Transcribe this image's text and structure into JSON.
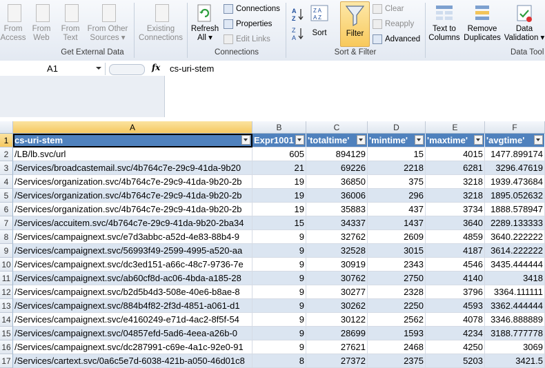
{
  "ribbon": {
    "get_external_data": {
      "label": "Get External Data",
      "buttons": [
        {
          "line1": "From",
          "line2": "Access"
        },
        {
          "line1": "From",
          "line2": "Web"
        },
        {
          "line1": "From",
          "line2": "Text"
        },
        {
          "line1": "From Other",
          "line2": "Sources ▾"
        },
        {
          "line1": "Existing",
          "line2": "Connections"
        }
      ]
    },
    "connections": {
      "label": "Connections",
      "refresh_line1": "Refresh",
      "refresh_line2": "All ▾",
      "connections": "Connections",
      "properties": "Properties",
      "edit_links": "Edit Links"
    },
    "sort_filter": {
      "label": "Sort & Filter",
      "sort": "Sort",
      "filter": "Filter",
      "clear": "Clear",
      "reapply": "Reapply",
      "advanced": "Advanced"
    },
    "data_tools": {
      "label": "Data Tool",
      "text_to_columns_1": "Text to",
      "text_to_columns_2": "Columns",
      "remove_duplicates_1": "Remove",
      "remove_duplicates_2": "Duplicates",
      "data_validation_1": "Data",
      "data_validation_2": "Validation ▾"
    }
  },
  "formula_bar": {
    "name_box": "A1",
    "fx": "fx",
    "formula": "cs-uri-stem"
  },
  "columns": [
    "A",
    "B",
    "C",
    "D",
    "E",
    "F"
  ],
  "header_row": {
    "num": "1",
    "cells": [
      "cs-uri-stem",
      "Expr1001",
      "'totaltime'",
      "'mintime'",
      "'maxtime'",
      "'avgtime'"
    ]
  },
  "rows": [
    {
      "num": "2",
      "cells": [
        "/LB/lb.svc/url",
        "605",
        "894129",
        "15",
        "4015",
        "1477.899174"
      ]
    },
    {
      "num": "3",
      "cells": [
        "/Services/broadcastemail.svc/4b764c7e-29c9-41da-9b20",
        "21",
        "69226",
        "2218",
        "6281",
        "3296.47619"
      ]
    },
    {
      "num": "4",
      "cells": [
        "/Services/organization.svc/4b764c7e-29c9-41da-9b20-2b",
        "19",
        "36850",
        "375",
        "3218",
        "1939.473684"
      ]
    },
    {
      "num": "5",
      "cells": [
        "/Services/organization.svc/4b764c7e-29c9-41da-9b20-2b",
        "19",
        "36006",
        "296",
        "3218",
        "1895.052632"
      ]
    },
    {
      "num": "6",
      "cells": [
        "/Services/organization.svc/4b764c7e-29c9-41da-9b20-2b",
        "19",
        "35883",
        "437",
        "3734",
        "1888.578947"
      ]
    },
    {
      "num": "7",
      "cells": [
        "/Services/accuitem.svc/4b764c7e-29c9-41da-9b20-2ba34",
        "15",
        "34337",
        "1437",
        "3640",
        "2289.133333"
      ]
    },
    {
      "num": "8",
      "cells": [
        "/Services/campaignext.svc/e7d3abbc-a52d-4e83-88b4-9",
        "9",
        "32762",
        "2609",
        "4859",
        "3640.222222"
      ]
    },
    {
      "num": "9",
      "cells": [
        "/Services/campaignext.svc/56993f49-2599-4995-a520-aa",
        "9",
        "32528",
        "3015",
        "4187",
        "3614.222222"
      ]
    },
    {
      "num": "10",
      "cells": [
        "/Services/campaignext.svc/dc3ed151-a66c-48c7-9736-7e",
        "9",
        "30919",
        "2343",
        "4546",
        "3435.444444"
      ]
    },
    {
      "num": "11",
      "cells": [
        "/Services/campaignext.svc/ab60cf8d-ac06-4bda-a185-28",
        "9",
        "30762",
        "2750",
        "4140",
        "3418"
      ]
    },
    {
      "num": "12",
      "cells": [
        "/Services/campaignext.svc/b2d5b4d3-508e-40e6-b8ae-8",
        "9",
        "30277",
        "2328",
        "3796",
        "3364.111111"
      ]
    },
    {
      "num": "13",
      "cells": [
        "/Services/campaignext.svc/884b4f82-2f3d-4851-a061-d1",
        "9",
        "30262",
        "2250",
        "4593",
        "3362.444444"
      ]
    },
    {
      "num": "14",
      "cells": [
        "/Services/campaignext.svc/e4160249-e71d-4ac2-8f5f-54",
        "9",
        "30122",
        "2562",
        "4078",
        "3346.888889"
      ]
    },
    {
      "num": "15",
      "cells": [
        "/Services/campaignext.svc/04857efd-5ad6-4eea-a26b-0",
        "9",
        "28699",
        "1593",
        "4234",
        "3188.777778"
      ]
    },
    {
      "num": "16",
      "cells": [
        "/Services/campaignext.svc/dc287991-c69e-4a1c-92e0-91",
        "9",
        "27621",
        "2468",
        "4250",
        "3069"
      ]
    },
    {
      "num": "17",
      "cells": [
        "/Services/cartext.svc/0a6c5e7d-6038-421b-a050-46d01c8",
        "8",
        "27372",
        "2375",
        "5203",
        "3421.5"
      ]
    }
  ]
}
